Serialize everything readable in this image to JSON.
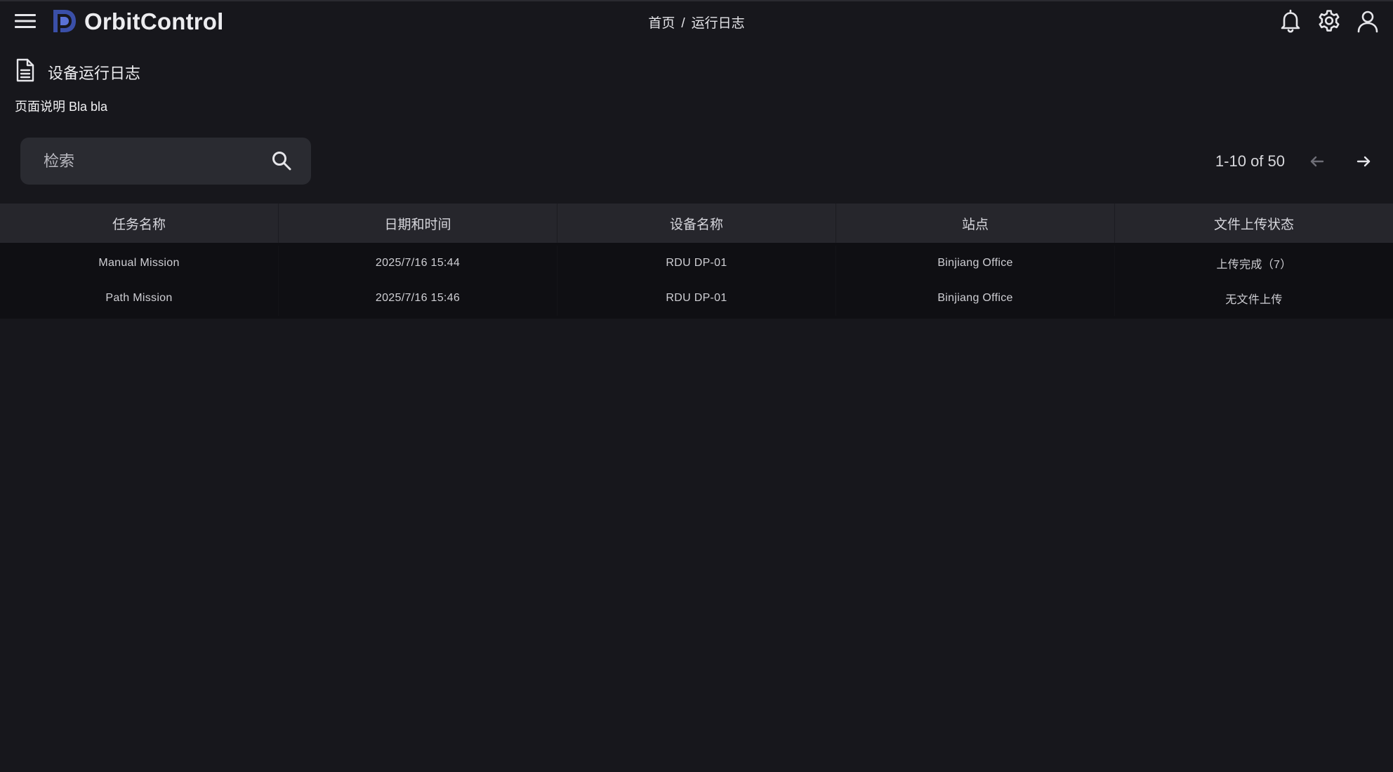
{
  "app": {
    "name": "OrbitControl",
    "brand_color": "#3a4fa8"
  },
  "breadcrumb": {
    "home": "首页",
    "separator": "/",
    "current": "运行日志"
  },
  "header_icons": [
    "bell-icon",
    "gear-icon",
    "user-icon"
  ],
  "page": {
    "icon": "document-icon",
    "title": "设备运行日志",
    "description": "页面说明 Bla bla"
  },
  "search": {
    "placeholder": "检索",
    "value": ""
  },
  "pagination": {
    "text": "1-10 of 50"
  },
  "table": {
    "columns": [
      "任务名称",
      "日期和时间",
      "设备名称",
      "站点",
      "文件上传状态"
    ],
    "rows": [
      [
        "Manual Mission",
        "2025/7/16 15:44",
        "RDU DP-01",
        "Binjiang Office",
        "上传完成（7）"
      ],
      [
        "Path Mission",
        "2025/7/16 15:46",
        "RDU DP-01",
        "Binjiang Office",
        "无文件上传"
      ]
    ]
  }
}
